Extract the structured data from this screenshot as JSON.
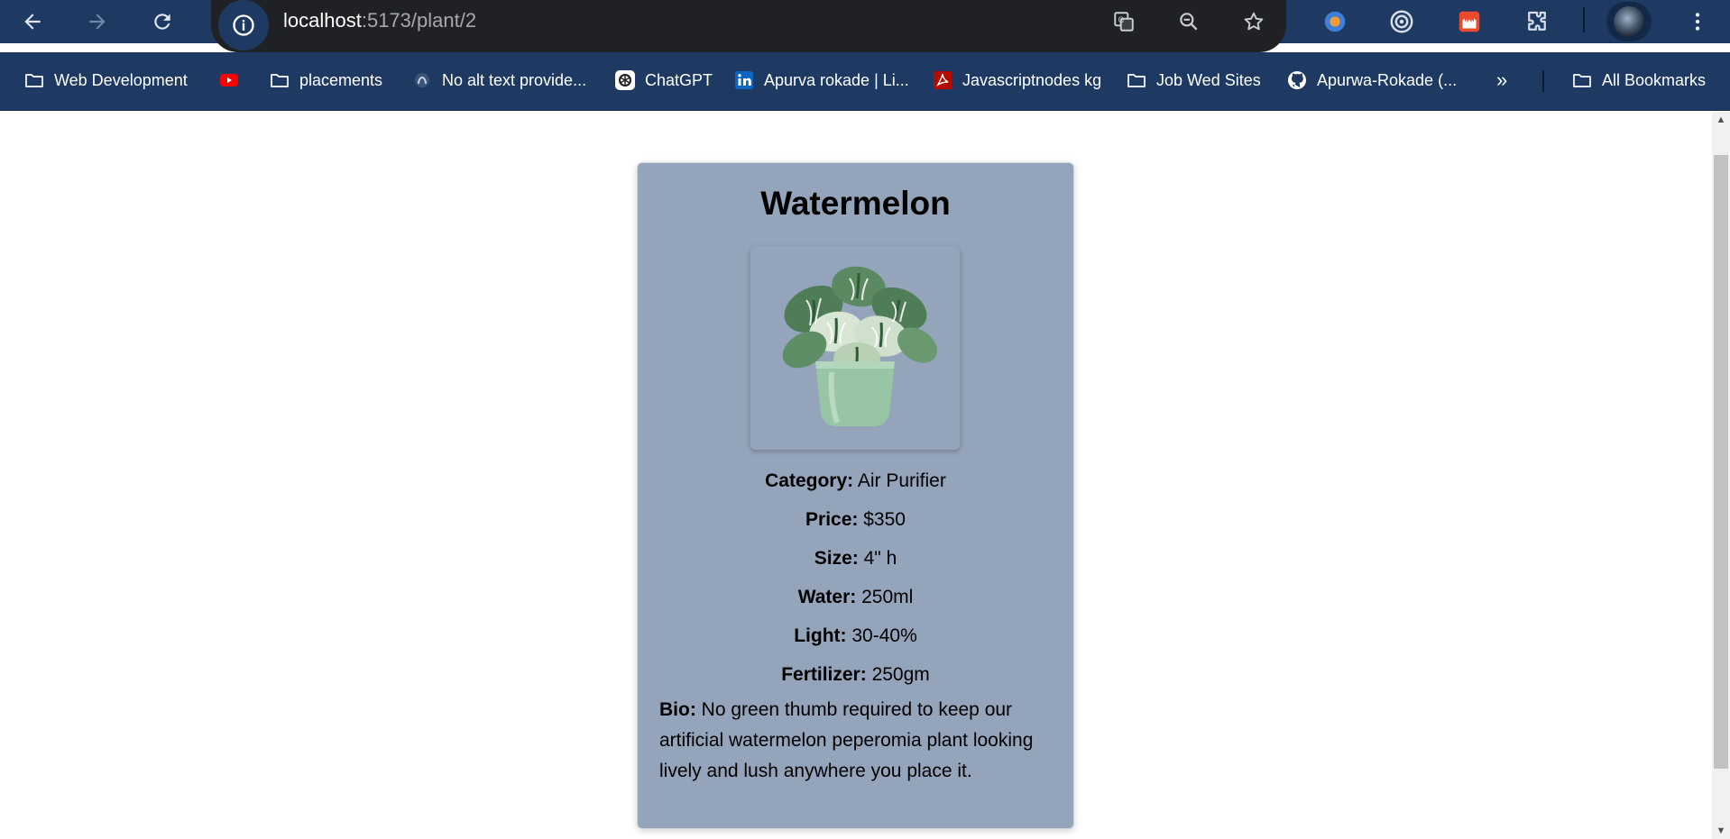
{
  "browser": {
    "url_host": "localhost",
    "url_path": ":5173/plant/2"
  },
  "bookmarks": [
    {
      "label": "Web Development",
      "icon": "folder-icon"
    },
    {
      "label": "",
      "icon": "youtube-icon"
    },
    {
      "label": "placements",
      "icon": "folder-icon"
    },
    {
      "label": "No alt text provide...",
      "icon": "site-icon"
    },
    {
      "label": "ChatGPT",
      "icon": "chatgpt-icon"
    },
    {
      "label": "Apurva rokade | Li...",
      "icon": "linkedin-icon"
    },
    {
      "label": "Javascriptnodes kg",
      "icon": "pdf-icon"
    },
    {
      "label": "Job Wed Sites",
      "icon": "folder-icon"
    },
    {
      "label": "Apurwa-Rokade (...",
      "icon": "github-icon"
    },
    {
      "label": "All Bookmarks",
      "icon": "folder-icon"
    }
  ],
  "plant": {
    "name": "Watermelon",
    "category_label": "Category:",
    "category": " Air Purifier",
    "price_label": "Price:",
    "price": " $350",
    "size_label": "Size:",
    "size": " 4\" h",
    "water_label": "Water:",
    "water": " 250ml",
    "light_label": "Light:",
    "light": " 30-40%",
    "fertilizer_label": "Fertilizer:",
    "fertilizer": " 250gm",
    "bio_label": "Bio:",
    "bio": " No green thumb required to keep our artificial watermelon peperomia plant looking lively and lush anywhere you place it."
  },
  "colors": {
    "browser_chrome": "#1e3a63",
    "omnibox": "#202124",
    "card": "#94a4ba",
    "pot": "#98c5a4",
    "leaf": "#4f7d57"
  }
}
